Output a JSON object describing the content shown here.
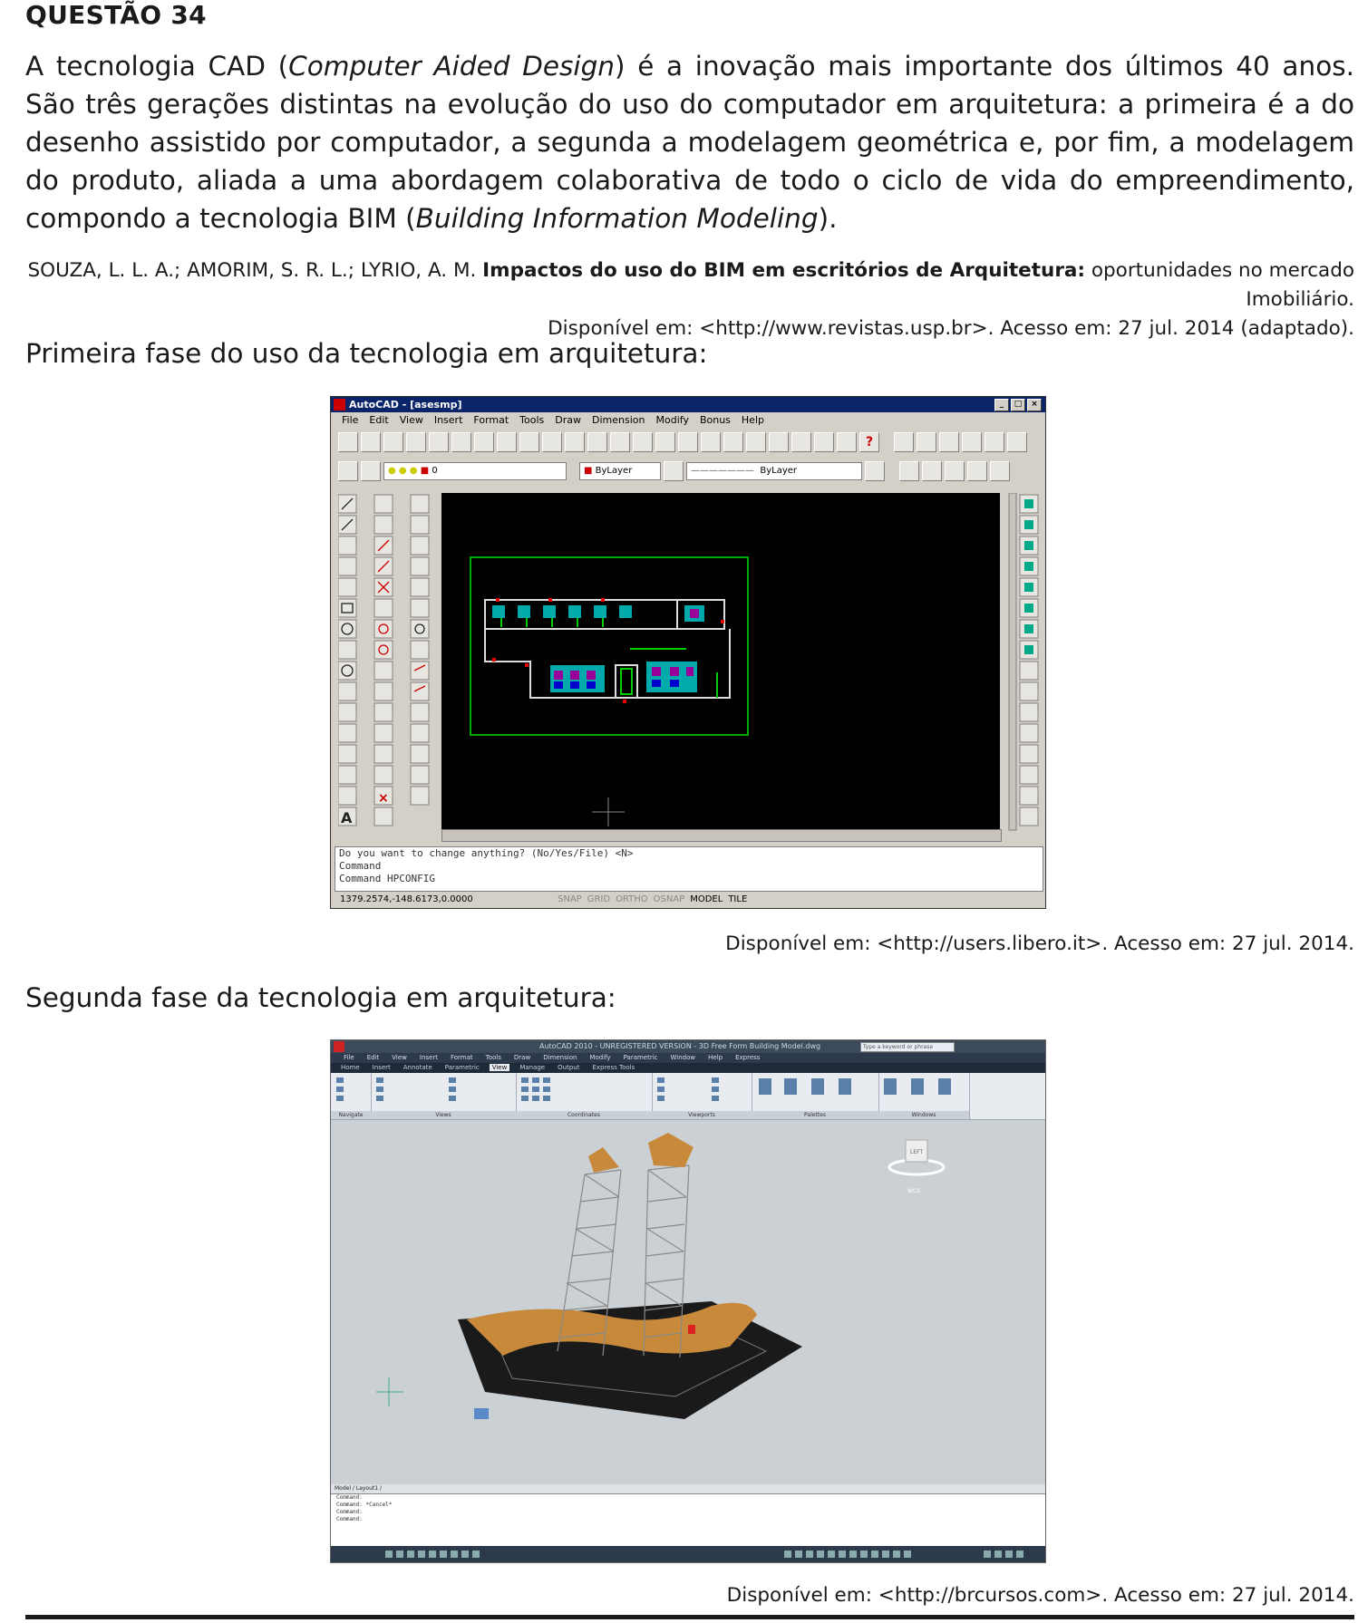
{
  "question": {
    "title": "QUESTÃO 34",
    "intro": {
      "p1": "A tecnologia CAD (",
      "i1": "Computer Aided Design",
      "p2": ") é a inovação mais importante dos últimos 40 anos. São três gerações distintas na evolução do uso do computador em arquitetura: a primeira é a do desenho assistido por computador, a segunda a modelagem geométrica e, por fim, a modelagem do produto, aliada a uma abordagem colaborativa de todo o ciclo de vida do empreendimento, compondo a tecnologia BIM (",
      "i2": "Building Information Modeling",
      "p3": ")."
    },
    "reference": {
      "authors": "SOUZA, L. L. A.; AMORIM, S. R. L.; LYRIO, A. M. ",
      "title_bold": "Impactos do uso do BIM em escritórios de Arquitetura:",
      "subtitle": " oportunidades no mercado Imobiliário.",
      "line2": "Disponível em: <http://www.revistas.usp.br>. Acesso em: 27 jul. 2014 (adaptado)."
    },
    "caption_first": "Primeira fase do uso da tecnologia em arquitetura:",
    "source_first": "Disponível em: <http://users.libero.it>. Acesso em: 27 jul. 2014.",
    "caption_second": "Segunda fase da tecnologia em arquitetura:",
    "source_second": "Disponível em: <http://brcursos.com>. Acesso em: 27 jul. 2014."
  },
  "screenshot1": {
    "title": "AutoCAD - [asesmp]",
    "menu": [
      "File",
      "Edit",
      "View",
      "Insert",
      "Format",
      "Tools",
      "Draw",
      "Dimension",
      "Modify",
      "Bonus",
      "Help"
    ],
    "layer_combo": "0",
    "color_combo": "ByLayer",
    "linetype_combo": "ByLayer",
    "command_lines": [
      "Do you want to change anything? (No/Yes/File) <N>",
      "Command",
      "Command  HPCONFIG"
    ],
    "coords": "1379.2574,-148.6173,0.0000",
    "modes": [
      "SNAP",
      "GRID",
      "ORTHO",
      "OSNAP",
      "MODEL",
      "TILE"
    ]
  },
  "screenshot2": {
    "title": "AutoCAD 2010 - UNREGISTERED VERSION - 3D Free Form Building Model.dwg",
    "search_placeholder": "Type a keyword or phrase",
    "menu": [
      "File",
      "Edit",
      "View",
      "Insert",
      "Format",
      "Tools",
      "Draw",
      "Dimension",
      "Modify",
      "Parametric",
      "Window",
      "Help",
      "Express"
    ],
    "tabs": [
      "Home",
      "Insert",
      "Annotate",
      "Parametric",
      "View",
      "Manage",
      "Output",
      "Express Tools"
    ],
    "active_tab": "View",
    "panels": [
      "Navigate",
      "Views",
      "Coordinates",
      "Viewports",
      "Palettes",
      "Windows"
    ],
    "layout_tabs": "Model / Layout1 /",
    "command_lines": [
      "Command:",
      "Command: *Cancel*",
      "Command:",
      "Command:"
    ],
    "viewcube_label": "LEFT",
    "wcs_label": "WCS"
  }
}
